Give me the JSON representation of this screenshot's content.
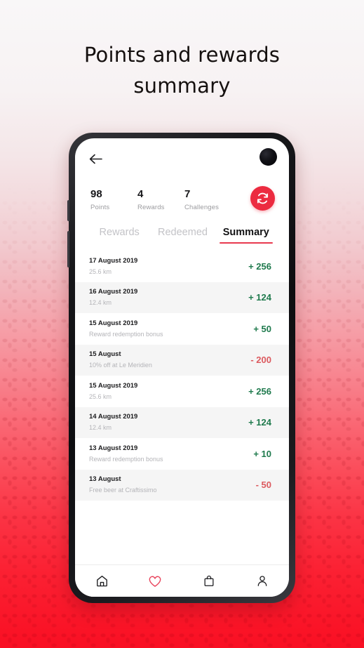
{
  "headline": {
    "line1": "Points and rewards",
    "line2": "summary"
  },
  "colors": {
    "accent_red": "#ec2b40",
    "tab_underline": "#e8394f",
    "positive": "#1f7a4d",
    "negative": "#dc5a5f",
    "heart_active": "#e8445c"
  },
  "app": {
    "topbar": {
      "back_icon": "arrow-left-icon"
    },
    "stats": [
      {
        "value": "98",
        "label": "Points"
      },
      {
        "value": "4",
        "label": "Rewards"
      },
      {
        "value": "7",
        "label": "Challenges"
      }
    ],
    "sync_button": {
      "icon": "refresh-icon"
    },
    "tabs": [
      {
        "label": "Rewards",
        "active": false
      },
      {
        "label": "Redeemed",
        "active": false
      },
      {
        "label": "Summary",
        "active": true
      }
    ],
    "transactions": [
      {
        "date": "17 August 2019",
        "detail": "25.6 km",
        "amount": "+ 256",
        "sign": "pos"
      },
      {
        "date": "16 August 2019",
        "detail": "12.4 km",
        "amount": "+ 124",
        "sign": "pos"
      },
      {
        "date": "15 August 2019",
        "detail": "Reward redemption bonus",
        "amount": "+ 50",
        "sign": "pos"
      },
      {
        "date": "15 August",
        "detail": "10% off at Le Meridien",
        "amount": "- 200",
        "sign": "neg"
      },
      {
        "date": "15 August 2019",
        "detail": "25.6 km",
        "amount": "+ 256",
        "sign": "pos"
      },
      {
        "date": "14 August 2019",
        "detail": "12.4 km",
        "amount": "+ 124",
        "sign": "pos"
      },
      {
        "date": "13 August 2019",
        "detail": "Reward redemption bonus",
        "amount": "+ 10",
        "sign": "pos"
      },
      {
        "date": "13 August",
        "detail": "Free beer at Craftissimo",
        "amount": "- 50",
        "sign": "neg"
      }
    ],
    "bottom_nav": [
      {
        "icon": "home-icon",
        "active": false
      },
      {
        "icon": "heart-icon",
        "active": true
      },
      {
        "icon": "bag-icon",
        "active": false
      },
      {
        "icon": "person-icon",
        "active": false
      }
    ]
  }
}
